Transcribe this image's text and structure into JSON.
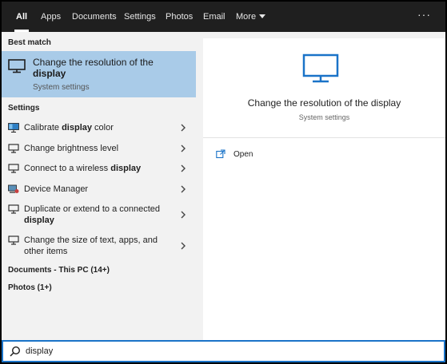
{
  "tabs": [
    {
      "label": "All"
    },
    {
      "label": "Apps"
    },
    {
      "label": "Documents"
    },
    {
      "label": "Settings"
    },
    {
      "label": "Photos"
    },
    {
      "label": "Email"
    },
    {
      "label": "More"
    }
  ],
  "overflow_label": "···",
  "left": {
    "best_match_heading": "Best match",
    "best_match": {
      "title_prefix": "Change the resolution of the",
      "title_bold": "display",
      "subtitle": "System settings",
      "icon": "monitor-icon"
    },
    "settings_heading": "Settings",
    "settings_items": [
      {
        "pre": "Calibrate ",
        "bold": "display",
        "post": " color",
        "icon": "calibrate-display-icon"
      },
      {
        "pre": "Change brightness level",
        "bold": "",
        "post": "",
        "icon": "monitor-icon"
      },
      {
        "pre": "Connect to a wireless ",
        "bold": "display",
        "post": "",
        "icon": "monitor-icon"
      },
      {
        "pre": "Device Manager",
        "bold": "",
        "post": "",
        "icon": "device-manager-icon"
      },
      {
        "pre": "Duplicate or extend to a connected",
        "bold": "display",
        "post": "",
        "icon": "monitor-icon"
      },
      {
        "pre": "Change the size of text, apps, and",
        "bold": "",
        "post": "other items",
        "icon": "monitor-icon"
      }
    ],
    "documents_heading": "Documents - This PC (14+)",
    "photos_heading": "Photos (1+)"
  },
  "right": {
    "title": "Change the resolution of the display",
    "subtitle": "System settings",
    "open_label": "Open",
    "icon": "monitor-icon"
  },
  "search": {
    "value": "display",
    "icon": "search-icon"
  },
  "colors": {
    "accent": "#1a73c8",
    "selection": "#a9cbe8",
    "topbar": "#1f1f1f"
  }
}
